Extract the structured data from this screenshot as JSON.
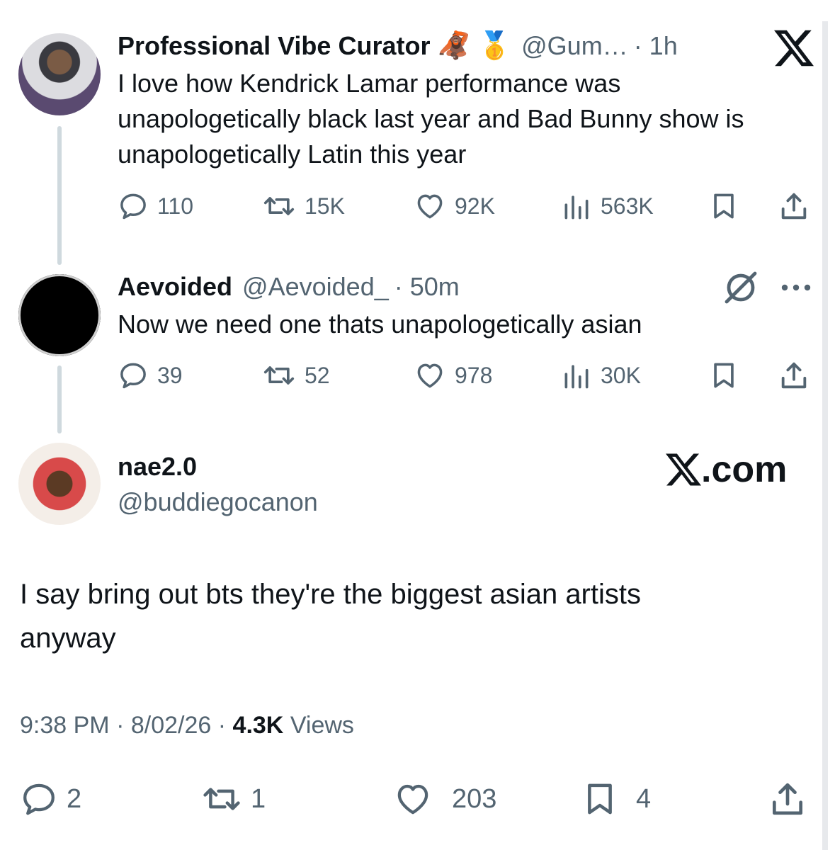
{
  "tweet1": {
    "name": "Professional Vibe Curator",
    "emoji1": "🦧",
    "emoji2": "🥇",
    "handle": "@Gum…",
    "time": "· 1h",
    "text_lines": [
      "I love how Kendrick Lamar performance was",
      "unapologetically black last year and Bad Bunny show is",
      "unapologetically Latin this year"
    ],
    "replies": "110",
    "reposts": "15K",
    "likes": "92K",
    "views": "563K"
  },
  "tweet2": {
    "name": "Aevoided",
    "handle": "@Aevoided_",
    "time": "· 50m",
    "text": "Now we need one thats unapologetically asian",
    "replies": "39",
    "reposts": "52",
    "likes": "978",
    "views": "30K"
  },
  "main_tweet": {
    "name": "nae2.0",
    "handle": "@buddiegocanon",
    "text_lines": [
      "I say bring out bts they're the biggest asian artists",
      "anyway"
    ],
    "time": "9:38 PM",
    "date": "8/02/26",
    "views_count": "4.3K",
    "views_label": "Views",
    "replies": "2",
    "reposts": "1",
    "likes": "203",
    "bookmarks": "4"
  },
  "brand": {
    "watermark_text": ".com",
    "accent": "#536471"
  },
  "icons": [
    "reply-icon",
    "repost-icon",
    "like-icon",
    "views-icon",
    "bookmark-icon",
    "share-icon",
    "x-logo-icon",
    "grok-icon",
    "more-icon"
  ]
}
